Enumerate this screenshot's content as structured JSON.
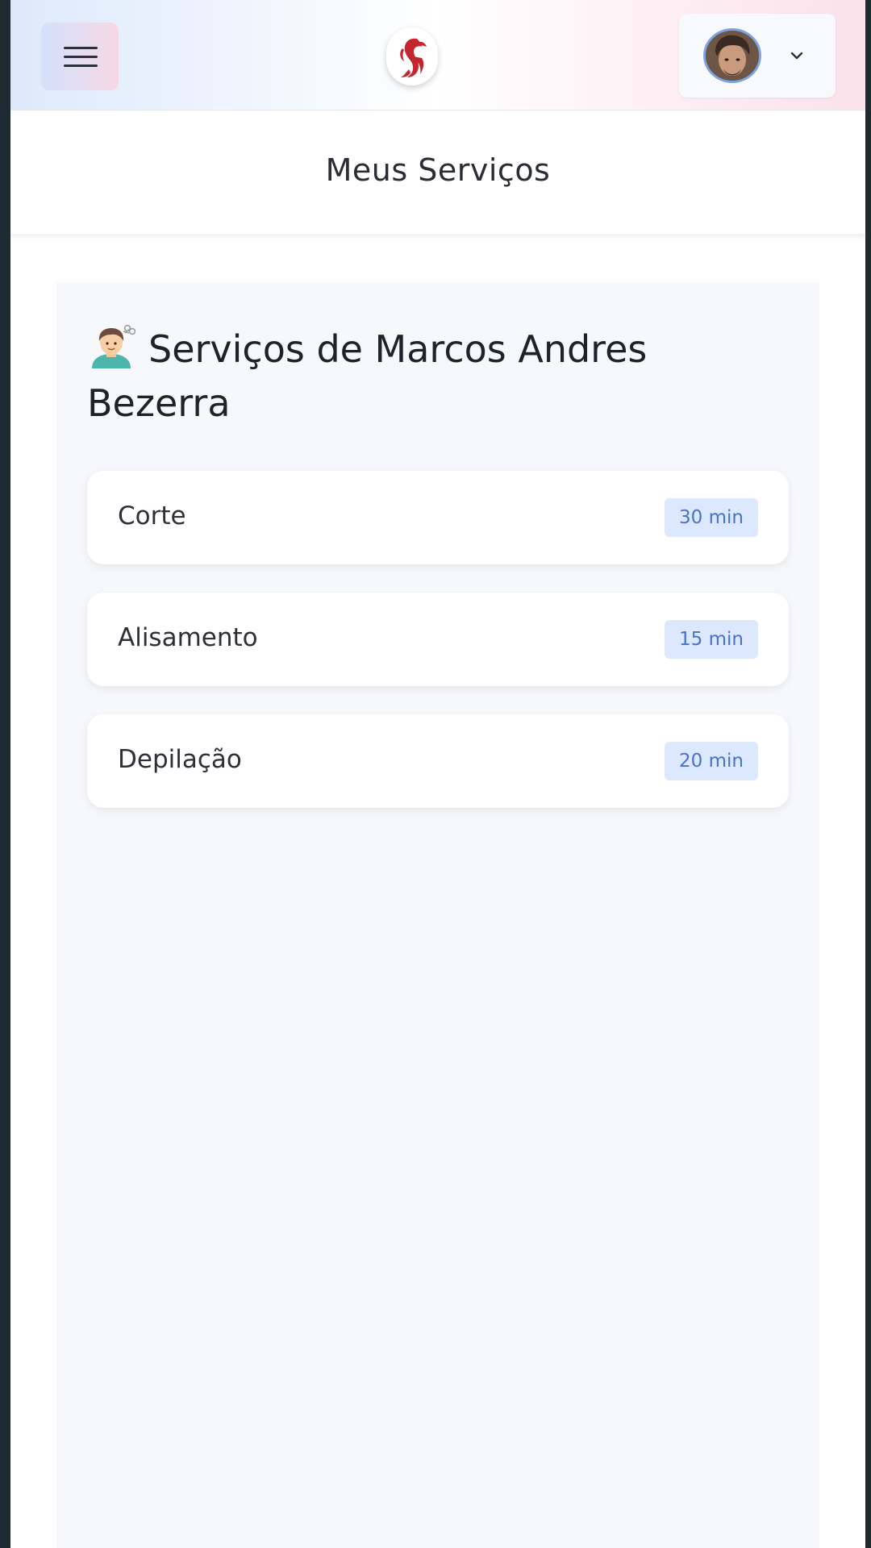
{
  "header": {
    "menu_icon": "hamburger-menu-icon",
    "logo_icon": "salon-logo-icon",
    "avatar_icon": "user-avatar",
    "profile_chevron_icon": "chevron-down-icon"
  },
  "page": {
    "title": "Meus Serviços"
  },
  "services_panel": {
    "heading_emoji": "💇‍♂️",
    "heading": "Serviços de Marcos Andres Bezerra",
    "items": [
      {
        "name": "Corte",
        "duration": "30 min"
      },
      {
        "name": "Alisamento",
        "duration": "15 min"
      },
      {
        "name": "Depilação",
        "duration": "20 min"
      }
    ]
  },
  "colors": {
    "badge_bg": "#dbe8fd",
    "badge_text": "#4c72c8",
    "logo_red": "#c3262f"
  }
}
